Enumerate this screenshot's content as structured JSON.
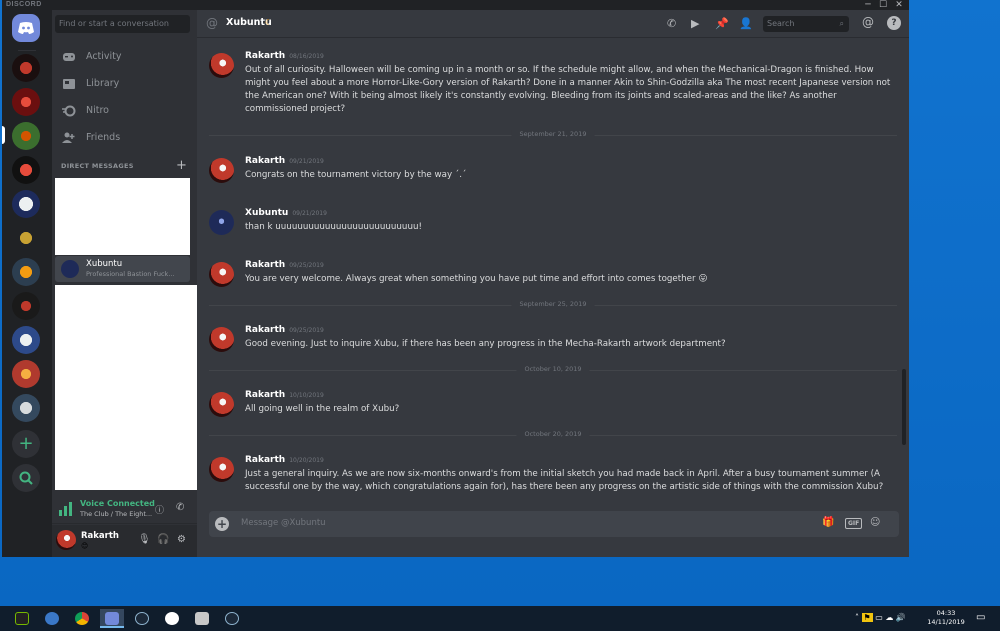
{
  "window": {
    "title": "DISCORD",
    "controls": [
      "─",
      "☐",
      "✕"
    ]
  },
  "dm_sidebar": {
    "search_placeholder": "Find or start a conversation",
    "nav": [
      {
        "label": "Activity",
        "icon": "activity-icon"
      },
      {
        "label": "Library",
        "icon": "library-icon"
      },
      {
        "label": "Nitro",
        "icon": "nitro-icon"
      },
      {
        "label": "Friends",
        "icon": "friends-icon"
      }
    ],
    "dm_header": "DIRECT MESSAGES",
    "dm_add": "+",
    "active_dm": {
      "name": "Xubuntu",
      "status": "Professional Bastion Fuck..."
    }
  },
  "voice": {
    "status": "Voice Connected",
    "channel": "The Club / The Eight..."
  },
  "user_panel": {
    "name": "Rakarth",
    "status_emoji": "😊"
  },
  "chat": {
    "at_symbol": "@",
    "channel": "Xubuntu",
    "status_icon": "☾",
    "search_placeholder": "Search",
    "composer_placeholder": "Message @Xubuntu",
    "gif_label": "GIF",
    "help": "?",
    "messages": [
      {
        "author": "Rakarth",
        "time": "08/16/2019",
        "avatar": "rakarth",
        "body": "Out of all curiosity. Halloween will be coming up in a month or so. If the schedule might allow, and when the Mechanical-Dragon is finished. How might you feel about a more Horror-Like-Gory version of Rakarth? Done in a manner Akin to Shin-Godzilla aka The most recent Japanese version not the American one? With it being almost likely it's constantly evolving. Bleeding from its joints and scaled-areas and the like? As another commissioned project?"
      },
      {
        "author": "Rakarth",
        "time": "09/21/2019",
        "avatar": "rakarth",
        "body": "Congrats on the tournament victory by the way ´.´"
      },
      {
        "author": "Xubuntu",
        "time": "09/21/2019",
        "avatar": "xubuntu",
        "body": "than k uuuuuuuuuuuuuuuuuuuuuuuuuu!"
      },
      {
        "author": "Rakarth",
        "time": "09/25/2019",
        "avatar": "rakarth",
        "body": "You are very welcome. Always great when something you have put time and effort into comes together 😛"
      },
      {
        "author": "Rakarth",
        "time": "09/25/2019",
        "avatar": "rakarth",
        "body": "Good evening. Just to inquire Xubu, if there has been any progress in the Mecha-Rakarth artwork department?"
      },
      {
        "author": "Rakarth",
        "time": "10/10/2019",
        "avatar": "rakarth",
        "body": "All going well in the realm of Xubu?"
      },
      {
        "author": "Rakarth",
        "time": "10/20/2019",
        "avatar": "rakarth",
        "body": "Just a general inquiry. As we are now six-months onward's from the initial sketch you had made back in April. After a busy tournament summer (A successful one by the way, which congratulations again for), has there been any progress on the artistic side of things with the commission Xubu?"
      }
    ],
    "dividers": [
      "September 21, 2019",
      "September 25, 2019",
      "October 10, 2019",
      "October 20, 2019"
    ]
  },
  "taskbar": {
    "time": "04:33",
    "date": "14/11/2019"
  }
}
